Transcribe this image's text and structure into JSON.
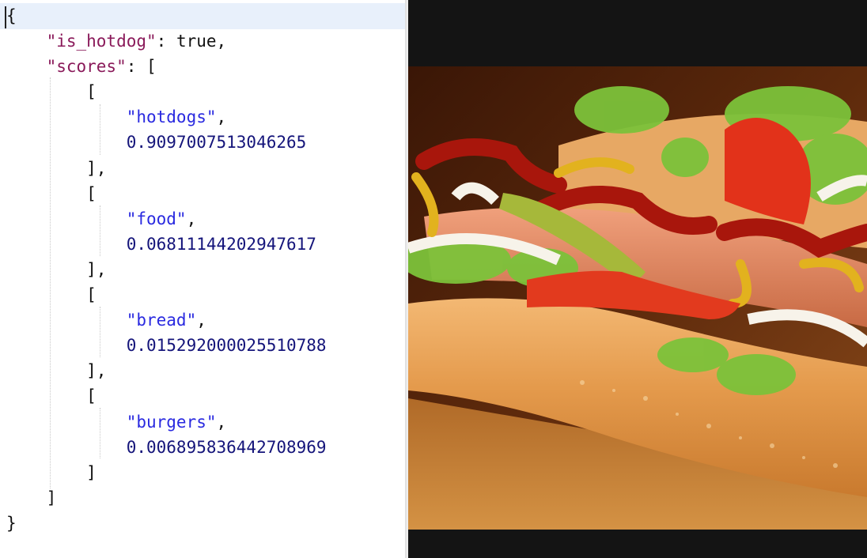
{
  "json_view": {
    "brace_open": "{",
    "is_hotdog_key": "\"is_hotdog\"",
    "is_hotdog_value": "true",
    "scores_key": "\"scores\"",
    "scores": [
      {
        "label": "\"hotdogs\"",
        "score": "0.9097007513046265"
      },
      {
        "label": "\"food\"",
        "score": "0.06811144202947617"
      },
      {
        "label": "\"bread\"",
        "score": "0.015292000025510788"
      },
      {
        "label": "\"burgers\"",
        "score": "0.006895836442708969"
      }
    ],
    "brace_close": "}"
  },
  "photo": {
    "subject": "hotdog-photo"
  },
  "colors": {
    "key": "#8a1a5a",
    "string": "#2a2ae0",
    "number": "#14147a",
    "highlight": "#e8f0fb",
    "viewer_bg": "#141414"
  }
}
